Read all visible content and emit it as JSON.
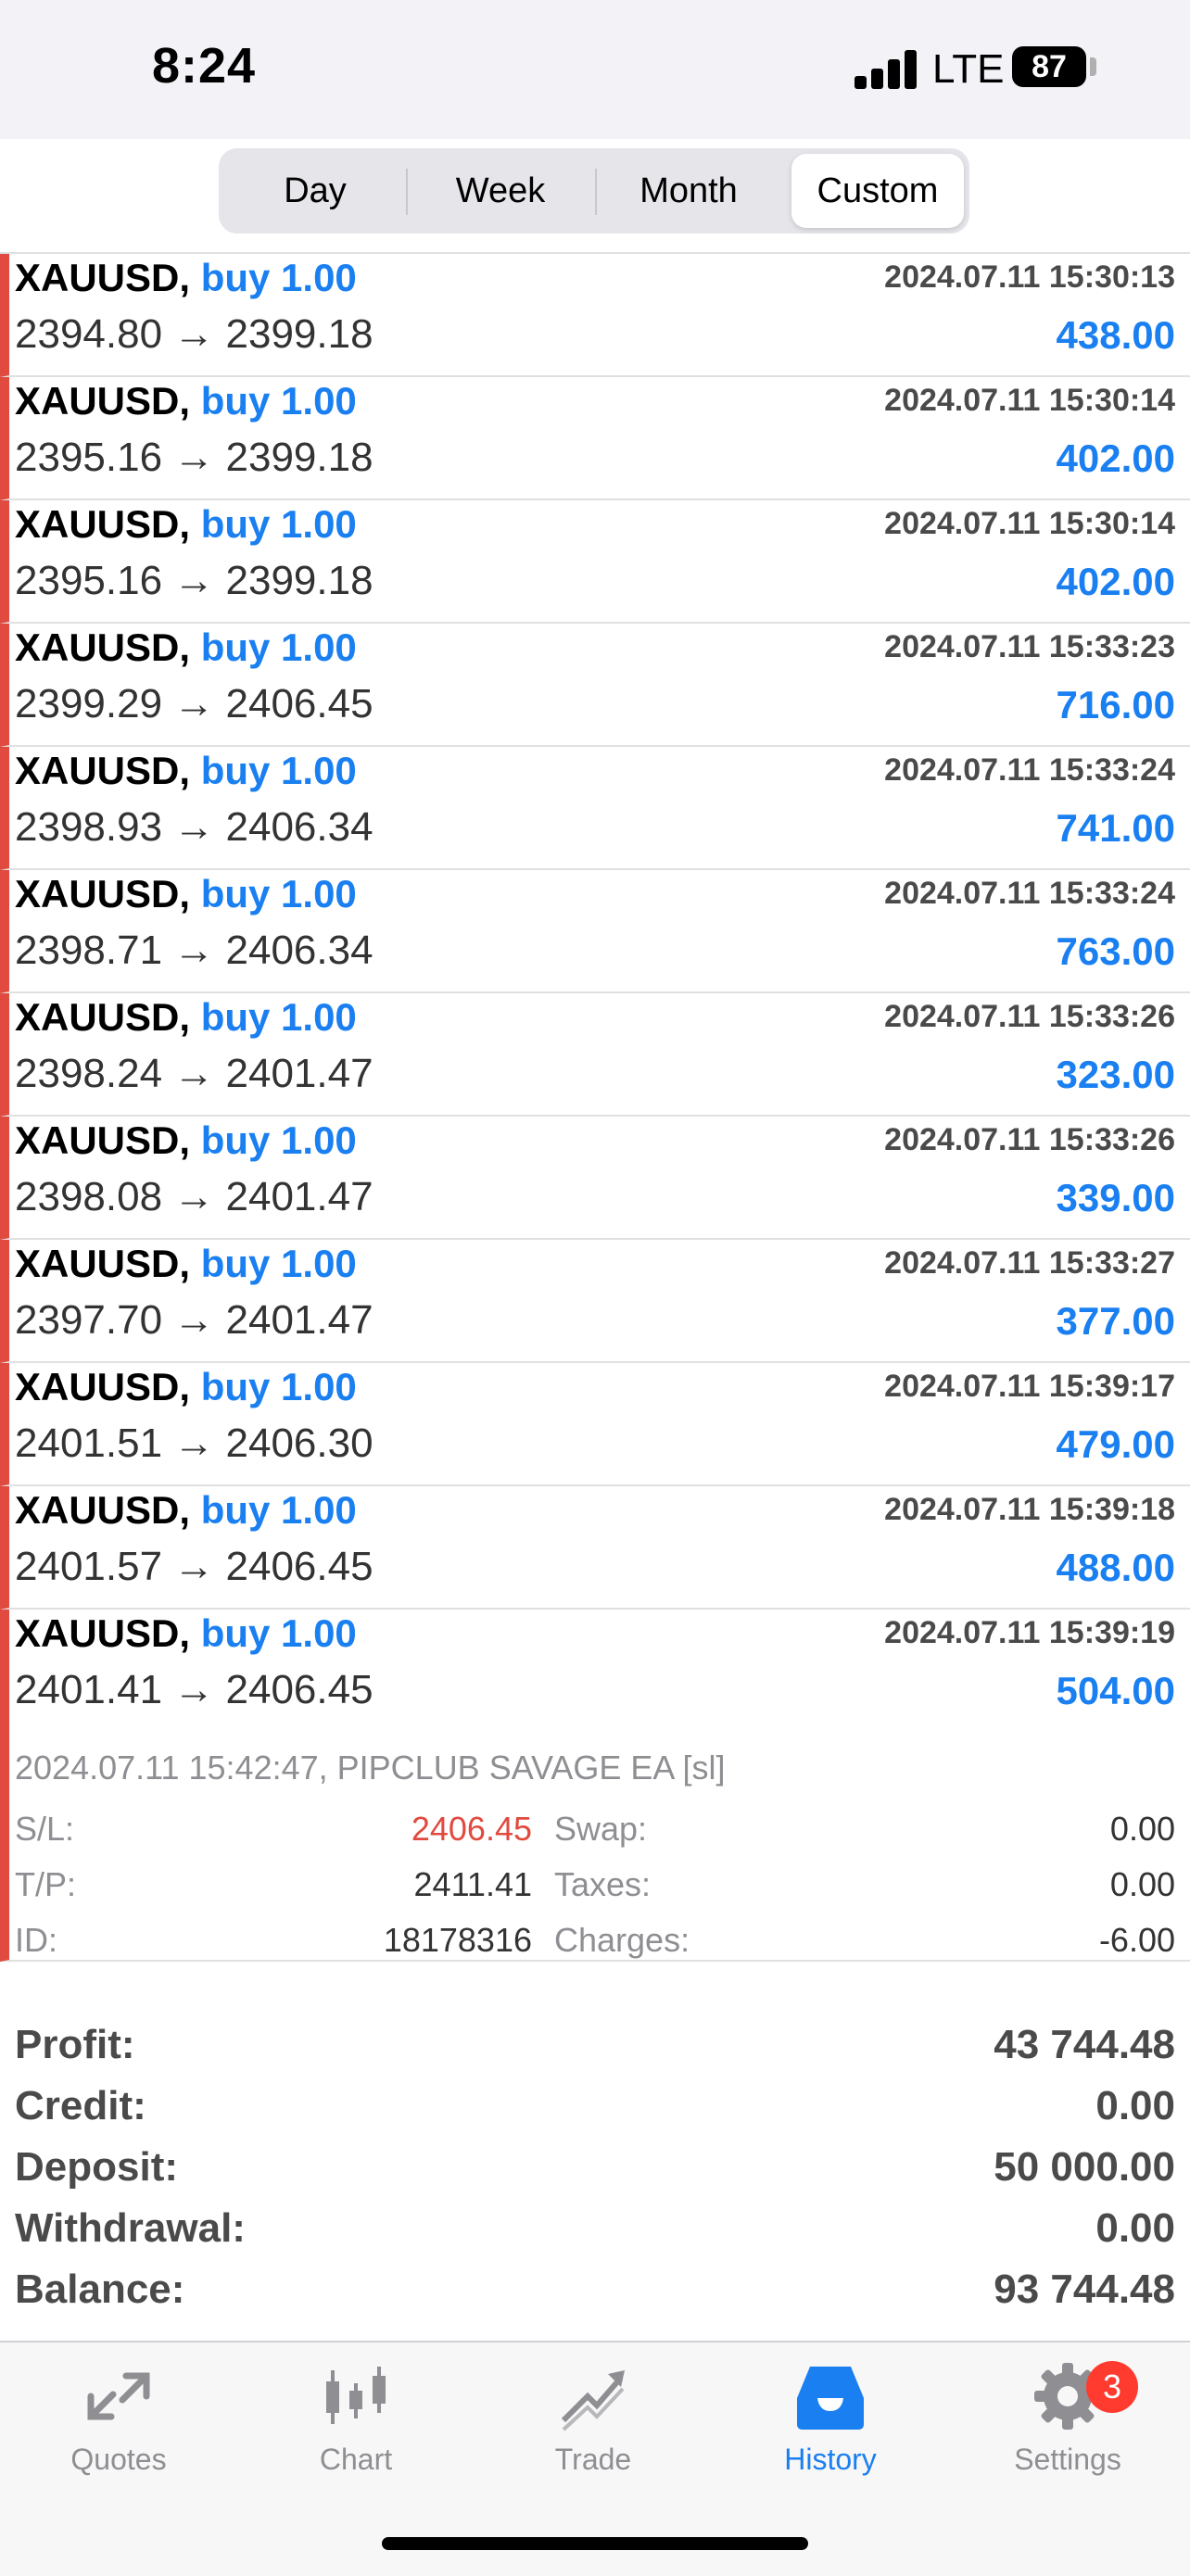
{
  "status_bar": {
    "time": "8:24",
    "network": "LTE",
    "battery": "87"
  },
  "segments": [
    {
      "label": "Day",
      "active": false
    },
    {
      "label": "Week",
      "active": false
    },
    {
      "label": "Month",
      "active": false
    },
    {
      "label": "Custom",
      "active": true
    }
  ],
  "deals": [
    {
      "symbol": "XAUUSD,",
      "side": "buy 1.00",
      "prices": "2394.80 → 2399.18",
      "time": "2024.07.11 15:30:13",
      "profit": "438.00"
    },
    {
      "symbol": "XAUUSD,",
      "side": "buy 1.00",
      "prices": "2395.16 → 2399.18",
      "time": "2024.07.11 15:30:14",
      "profit": "402.00"
    },
    {
      "symbol": "XAUUSD,",
      "side": "buy 1.00",
      "prices": "2395.16 → 2399.18",
      "time": "2024.07.11 15:30:14",
      "profit": "402.00"
    },
    {
      "symbol": "XAUUSD,",
      "side": "buy 1.00",
      "prices": "2399.29 → 2406.45",
      "time": "2024.07.11 15:33:23",
      "profit": "716.00"
    },
    {
      "symbol": "XAUUSD,",
      "side": "buy 1.00",
      "prices": "2398.93 → 2406.34",
      "time": "2024.07.11 15:33:24",
      "profit": "741.00"
    },
    {
      "symbol": "XAUUSD,",
      "side": "buy 1.00",
      "prices": "2398.71 → 2406.34",
      "time": "2024.07.11 15:33:24",
      "profit": "763.00"
    },
    {
      "symbol": "XAUUSD,",
      "side": "buy 1.00",
      "prices": "2398.24 → 2401.47",
      "time": "2024.07.11 15:33:26",
      "profit": "323.00"
    },
    {
      "symbol": "XAUUSD,",
      "side": "buy 1.00",
      "prices": "2398.08 → 2401.47",
      "time": "2024.07.11 15:33:26",
      "profit": "339.00"
    },
    {
      "symbol": "XAUUSD,",
      "side": "buy 1.00",
      "prices": "2397.70 → 2401.47",
      "time": "2024.07.11 15:33:27",
      "profit": "377.00"
    },
    {
      "symbol": "XAUUSD,",
      "side": "buy 1.00",
      "prices": "2401.51 → 2406.30",
      "time": "2024.07.11 15:39:17",
      "profit": "479.00"
    },
    {
      "symbol": "XAUUSD,",
      "side": "buy 1.00",
      "prices": "2401.57 → 2406.45",
      "time": "2024.07.11 15:39:18",
      "profit": "488.00"
    },
    {
      "symbol": "XAUUSD,",
      "side": "buy 1.00",
      "prices": "2401.41 → 2406.45",
      "time": "2024.07.11 15:39:19",
      "profit": "504.00"
    }
  ],
  "detail": {
    "comment": "2024.07.11 15:42:47, PIPCLUB SAVAGE EA [sl]",
    "sl_label": "S/L:",
    "sl_value": "2406.45",
    "tp_label": "T/P:",
    "tp_value": "2411.41",
    "id_label": "ID:",
    "id_value": "18178316",
    "swap_label": "Swap:",
    "swap_value": "0.00",
    "taxes_label": "Taxes:",
    "taxes_value": "0.00",
    "charges_label": "Charges:",
    "charges_value": "-6.00"
  },
  "summary": [
    {
      "label": "Profit:",
      "value": "43 744.48"
    },
    {
      "label": "Credit:",
      "value": "0.00"
    },
    {
      "label": "Deposit:",
      "value": "50 000.00"
    },
    {
      "label": "Withdrawal:",
      "value": "0.00"
    },
    {
      "label": "Balance:",
      "value": "93 744.48"
    }
  ],
  "tabs": [
    {
      "label": "Quotes",
      "icon": "quotes-icon",
      "active": false
    },
    {
      "label": "Chart",
      "icon": "chart-icon",
      "active": false
    },
    {
      "label": "Trade",
      "icon": "trade-icon",
      "active": false
    },
    {
      "label": "History",
      "icon": "history-icon",
      "active": true
    },
    {
      "label": "Settings",
      "icon": "gear-icon",
      "active": false,
      "badge": "3"
    }
  ],
  "colors": {
    "accent": "#1a7ff0",
    "loss": "#e04a3f",
    "badge": "#ff3b30"
  }
}
